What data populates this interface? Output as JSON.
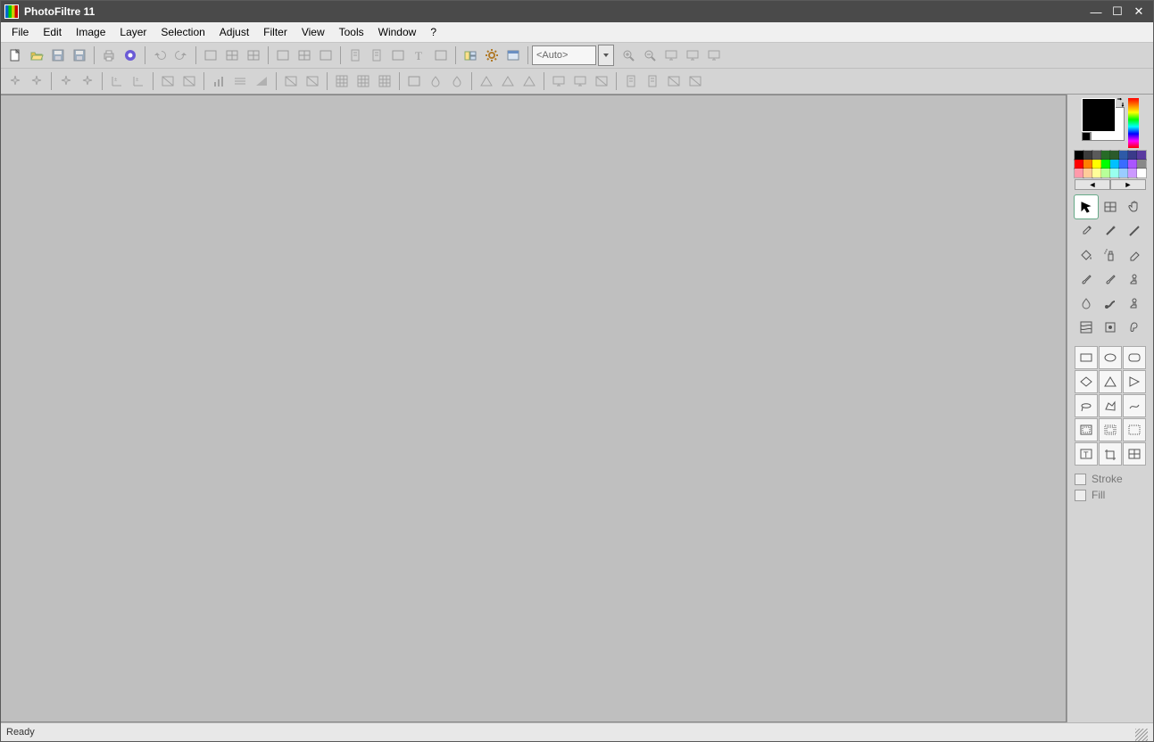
{
  "app": {
    "title": "PhotoFiltre 11"
  },
  "menu": [
    "File",
    "Edit",
    "Image",
    "Layer",
    "Selection",
    "Adjust",
    "Filter",
    "View",
    "Tools",
    "Window",
    "?"
  ],
  "toolbar1_buttons": [
    {
      "name": "new-file-icon",
      "enabled": true
    },
    {
      "name": "open-file-icon",
      "enabled": true
    },
    {
      "name": "save-icon",
      "enabled": false
    },
    {
      "name": "save-as-icon",
      "enabled": false
    },
    {
      "sep": true
    },
    {
      "name": "print-icon",
      "enabled": false
    },
    {
      "name": "twain-icon",
      "enabled": true
    },
    {
      "sep": true
    },
    {
      "name": "undo-icon",
      "enabled": false
    },
    {
      "name": "redo-icon",
      "enabled": false
    },
    {
      "sep": true
    },
    {
      "name": "image-mode-rgb-icon",
      "enabled": false
    },
    {
      "name": "image-mode-indexed-icon",
      "enabled": false
    },
    {
      "name": "image-mode-to-rgb-icon",
      "enabled": false
    },
    {
      "sep": true
    },
    {
      "name": "transparent-color-icon",
      "enabled": false
    },
    {
      "name": "layer-manager-icon",
      "enabled": false
    },
    {
      "name": "image-size-icon",
      "enabled": false
    },
    {
      "sep": true
    },
    {
      "name": "copy-icon",
      "enabled": false
    },
    {
      "name": "paste-icon",
      "enabled": false
    },
    {
      "name": "selection-all-icon",
      "enabled": false
    },
    {
      "name": "text-tool-icon",
      "enabled": false
    },
    {
      "name": "selection-crop-icon",
      "enabled": false
    },
    {
      "sep": true
    },
    {
      "name": "explorer-icon",
      "enabled": true
    },
    {
      "name": "automate-icon",
      "enabled": true
    },
    {
      "name": "preferences-icon",
      "enabled": true
    }
  ],
  "zoom": {
    "combo_text": "<Auto>"
  },
  "toolbar1_right_buttons": [
    {
      "name": "zoom-in-icon",
      "enabled": false
    },
    {
      "name": "zoom-out-icon",
      "enabled": false
    },
    {
      "name": "fit-window-icon",
      "enabled": false
    },
    {
      "name": "fit-image-icon",
      "enabled": false
    },
    {
      "name": "fullscreen-icon",
      "enabled": false
    }
  ],
  "toolbar2_buttons": [
    {
      "name": "brightness-minus-icon"
    },
    {
      "name": "brightness-plus-icon"
    },
    {
      "sep": true
    },
    {
      "name": "contrast-minus-icon"
    },
    {
      "name": "contrast-plus-icon"
    },
    {
      "sep": true
    },
    {
      "name": "gamma-minus-icon"
    },
    {
      "name": "gamma-plus-icon"
    },
    {
      "sep": true
    },
    {
      "name": "saturation-minus-icon"
    },
    {
      "name": "saturation-plus-icon"
    },
    {
      "sep": true
    },
    {
      "name": "histogram-icon"
    },
    {
      "name": "levels-icon"
    },
    {
      "name": "grayscale-ramp-icon"
    },
    {
      "sep": true
    },
    {
      "name": "hue-up-icon"
    },
    {
      "name": "hue-down-icon"
    },
    {
      "sep": true
    },
    {
      "name": "grid-a-icon"
    },
    {
      "name": "grid-b-icon"
    },
    {
      "name": "grid-c-icon"
    },
    {
      "sep": true
    },
    {
      "name": "blur-a-icon"
    },
    {
      "name": "blur-drop-icon"
    },
    {
      "name": "blur-outline-icon"
    },
    {
      "sep": true
    },
    {
      "name": "sharpen-icon"
    },
    {
      "name": "relief-a-icon"
    },
    {
      "name": "relief-b-icon"
    },
    {
      "sep": true
    },
    {
      "name": "fx-a-icon"
    },
    {
      "name": "fx-b-icon"
    },
    {
      "name": "fx-c-icon"
    },
    {
      "sep": true
    },
    {
      "name": "module-a-icon"
    },
    {
      "name": "module-b-icon"
    },
    {
      "name": "module-c-icon"
    },
    {
      "name": "module-d-icon"
    }
  ],
  "palette_colors": [
    "#000000",
    "#3b3b3b",
    "#5a5a5a",
    "#276b27",
    "#2b5a2b",
    "#2e5aa7",
    "#3a3a8a",
    "#5a3aa0",
    "#ff0000",
    "#ff8000",
    "#ffff00",
    "#00ff00",
    "#00c0ff",
    "#3a6cff",
    "#aa55ff",
    "#888888",
    "#ff99aa",
    "#ffcc99",
    "#ffff99",
    "#b8ff99",
    "#99ffee",
    "#99ccff",
    "#cc99ff",
    "#ffffff"
  ],
  "tools": [
    {
      "name": "selection-tool-icon",
      "active": true
    },
    {
      "name": "layer-tool-icon"
    },
    {
      "name": "hand-tool-icon"
    },
    {
      "name": "pipette-tool-icon"
    },
    {
      "name": "wand-tool-icon"
    },
    {
      "name": "line-tool-icon"
    },
    {
      "name": "fill-tool-icon"
    },
    {
      "name": "spray-tool-icon"
    },
    {
      "name": "eraser-tool-icon"
    },
    {
      "name": "brush-tool-icon"
    },
    {
      "name": "adv-brush-tool-icon"
    },
    {
      "name": "stamp-tool-icon"
    },
    {
      "name": "blur-tool-icon"
    },
    {
      "name": "smudge-tool-icon"
    },
    {
      "name": "clone-tool-icon"
    },
    {
      "name": "deform-tool-icon"
    },
    {
      "name": "retouch-tool-icon"
    },
    {
      "name": "art-tool-icon"
    }
  ],
  "shapes": [
    "rectangle",
    "ellipse",
    "rounded-rect",
    "diamond",
    "triangle",
    "triangle-right",
    "lasso",
    "poly-lasso",
    "freeform",
    "inset-a",
    "inset-b",
    "inset-c",
    "text-box",
    "crop",
    "grid"
  ],
  "shape_options": {
    "stroke_label": "Stroke",
    "fill_label": "Fill"
  },
  "status": {
    "text": "Ready"
  }
}
